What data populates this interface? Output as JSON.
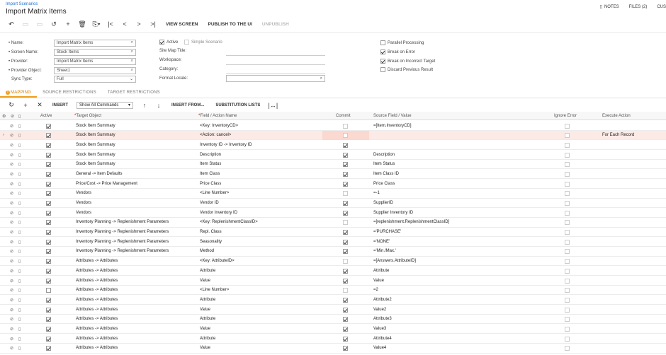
{
  "header": {
    "breadcrumb": "Import Scenarios",
    "title": "Import Matrix Items",
    "notes": "NOTES",
    "files": "FILES (2)",
    "cust": "CUS"
  },
  "toolbar": {
    "view_screen": "VIEW SCREEN",
    "publish": "PUBLISH TO THE UI",
    "unpublish": "UNPUBLISH"
  },
  "form": {
    "name_label": "• Name:",
    "name_value": "Import Matrix Items",
    "screen_label": "• Screen Name:",
    "screen_value": "Stock Items",
    "provider_label": "• Provider:",
    "provider_value": "Import Matrix Items",
    "provider_object_label": "• Provider Object:",
    "provider_object_value": "Sheet1",
    "sync_label": "Sync Type:",
    "sync_value": "Full",
    "active_label": "Active",
    "simple_label": "Simple Scenario",
    "site_map_label": "Site Map Title:",
    "workspace_label": "Workspace:",
    "category_label": "Category:",
    "format_locale_label": "Format Locale:",
    "parallel_label": "Parallel Processing",
    "break_error_label": "Break on Error",
    "break_target_label": "Break on Incorrect Target",
    "discard_label": "Discard Previous Result"
  },
  "tabs": [
    "MAPPING",
    "SOURCE RESTRICTIONS",
    "TARGET RESTRICTIONS"
  ],
  "grid_toolbar": {
    "insert": "INSERT",
    "show_select": "Show All Commands",
    "insert_from": "INSERT FROM...",
    "substitution": "SUBSTITUTION LISTS"
  },
  "columns": {
    "active": "Active",
    "target": "Target Object",
    "field": "Field / Action Name",
    "commit": "Commit",
    "source": "Source Field / Value",
    "ignore": "Ignore Error",
    "execute": "Execute Action"
  },
  "rows": [
    {
      "target": "Stock Item Summary",
      "field": "<Key: InventoryCD>",
      "source": "=[Item.InventoryCD]",
      "execute": "",
      "active": true,
      "commit": false
    },
    {
      "target": "Stock Item Summary",
      "field": "<Action: cancel>",
      "source": "",
      "execute": "For Each Record",
      "active": true,
      "commit": false
    },
    {
      "target": "Stock Item Summary",
      "field": "Inventory ID -> Inventory ID",
      "source": "",
      "execute": "",
      "active": true,
      "commit": true
    },
    {
      "target": "Stock Item Summary",
      "field": "Description",
      "source": "Description",
      "execute": "",
      "active": true,
      "commit": true
    },
    {
      "target": "Stock Item Summary",
      "field": "Item Status",
      "source": "Item Status",
      "execute": "",
      "active": true,
      "commit": true
    },
    {
      "target": "General -> Item Defaults",
      "field": "Item Class",
      "source": "Item Class ID",
      "execute": "",
      "active": true,
      "commit": true
    },
    {
      "target": "Price/Cost -> Price Management",
      "field": "Price Class",
      "source": "Price Class",
      "execute": "",
      "active": true,
      "commit": true
    },
    {
      "target": "Vendors",
      "field": "<Line Number>",
      "source": "=-1",
      "execute": "",
      "active": true,
      "commit": false
    },
    {
      "target": "Vendors",
      "field": "Vendor ID",
      "source": "SupplierID",
      "execute": "",
      "active": true,
      "commit": true
    },
    {
      "target": "Vendors",
      "field": "Vendor Inventory ID",
      "source": "Supplier Inventory ID",
      "execute": "",
      "active": true,
      "commit": true
    },
    {
      "target": "Inventory Planning -> Replenishment Parameters",
      "field": "<Key: ReplenishmentClassID>",
      "source": "=[replenishment.ReplenishmentClassID]",
      "execute": "",
      "active": true,
      "commit": false
    },
    {
      "target": "Inventory Planning -> Replenishment Parameters",
      "field": "Repl. Class",
      "source": "='PURCHASE'",
      "execute": "",
      "active": true,
      "commit": true
    },
    {
      "target": "Inventory Planning -> Replenishment Parameters",
      "field": "Seasonality",
      "source": "='NONE'",
      "execute": "",
      "active": true,
      "commit": true
    },
    {
      "target": "Inventory Planning -> Replenishment Parameters",
      "field": "Method",
      "source": "='Min./Max.'",
      "execute": "",
      "active": true,
      "commit": true
    },
    {
      "target": "Attributes -> Attributes",
      "field": "<Key: AttributeID>",
      "source": "=[Answers.AttributeID]",
      "execute": "",
      "active": true,
      "commit": false
    },
    {
      "target": "Attributes -> Attributes",
      "field": "Attribute",
      "source": "Attribute",
      "execute": "",
      "active": true,
      "commit": true
    },
    {
      "target": "Attributes -> Attributes",
      "field": "Value",
      "source": "Value",
      "execute": "",
      "active": true,
      "commit": true
    },
    {
      "target": "Attributes -> Attributes",
      "field": "<Line Number>",
      "source": "=2",
      "execute": "",
      "active": false,
      "commit": false
    },
    {
      "target": "Attributes -> Attributes",
      "field": "Attribute",
      "source": "Attribute2",
      "execute": "",
      "active": true,
      "commit": true
    },
    {
      "target": "Attributes -> Attributes",
      "field": "Value",
      "source": "Value2",
      "execute": "",
      "active": true,
      "commit": true
    },
    {
      "target": "Attributes -> Attributes",
      "field": "Attribute",
      "source": "Attribute3",
      "execute": "",
      "active": true,
      "commit": true
    },
    {
      "target": "Attributes -> Attributes",
      "field": "Value",
      "source": "Value3",
      "execute": "",
      "active": true,
      "commit": true
    },
    {
      "target": "Attributes -> Attributes",
      "field": "Attribute",
      "source": "Attribute4",
      "execute": "",
      "active": true,
      "commit": true
    },
    {
      "target": "Attributes -> Attributes",
      "field": "Value",
      "source": "Value4",
      "execute": "",
      "active": true,
      "commit": true
    }
  ]
}
